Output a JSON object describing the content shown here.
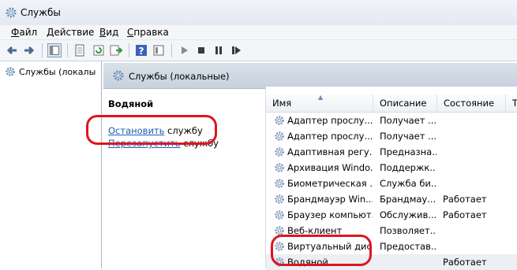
{
  "window": {
    "title": "Службы"
  },
  "menu": [
    {
      "label_u": "Ф",
      "label_rest": "айл"
    },
    {
      "label_u": "Д",
      "label_rest": "ействие"
    },
    {
      "label_u": "В",
      "label_rest": "ид"
    },
    {
      "label_u": "С",
      "label_rest": "правка"
    }
  ],
  "toolbar": {
    "buttons": [
      "back-arrow-icon",
      "forward-arrow-icon",
      "show-tree-icon",
      "properties-icon",
      "refresh-icon",
      "export-icon",
      "help-icon",
      "console-icon",
      "play-icon",
      "stop-icon",
      "pause-icon",
      "restart-icon"
    ]
  },
  "tree": {
    "item_label": "Службы (локалы"
  },
  "pane": {
    "header": "Службы (локальные)"
  },
  "details": {
    "service_name": "Водяной",
    "stop_link": "Остановить",
    "stop_suffix": " службу",
    "restart_link": "Перезапустить",
    "restart_suffix": " службу"
  },
  "table": {
    "columns": [
      "Имя",
      "Описание",
      "Состояние",
      "Т"
    ],
    "rows": [
      {
        "name": "Адаптер прослу...",
        "desc": "Получает ...",
        "state": ""
      },
      {
        "name": "Адаптер прослу...",
        "desc": "Получает ...",
        "state": ""
      },
      {
        "name": "Адаптивная регу...",
        "desc": "Предназна...",
        "state": ""
      },
      {
        "name": "Архивация Windo...",
        "desc": "Поддержк...",
        "state": ""
      },
      {
        "name": "Биометрическая ...",
        "desc": "Служба би...",
        "state": ""
      },
      {
        "name": "Брандмауэр Win...",
        "desc": "Брандмау...",
        "state": "Работает"
      },
      {
        "name": "Браузер компьют...",
        "desc": "Обслужив...",
        "state": "Работает"
      },
      {
        "name": "Веб-клиент",
        "desc": "Позволяет...",
        "state": ""
      },
      {
        "name": "Виртуальный дис...",
        "desc": "Предостав...",
        "state": ""
      },
      {
        "name": "Водяной",
        "desc": "",
        "state": "Работает",
        "selected": true
      }
    ]
  },
  "colors": {
    "annotation": "#e0141f",
    "link": "#1a5fb4",
    "running": "#000000"
  }
}
